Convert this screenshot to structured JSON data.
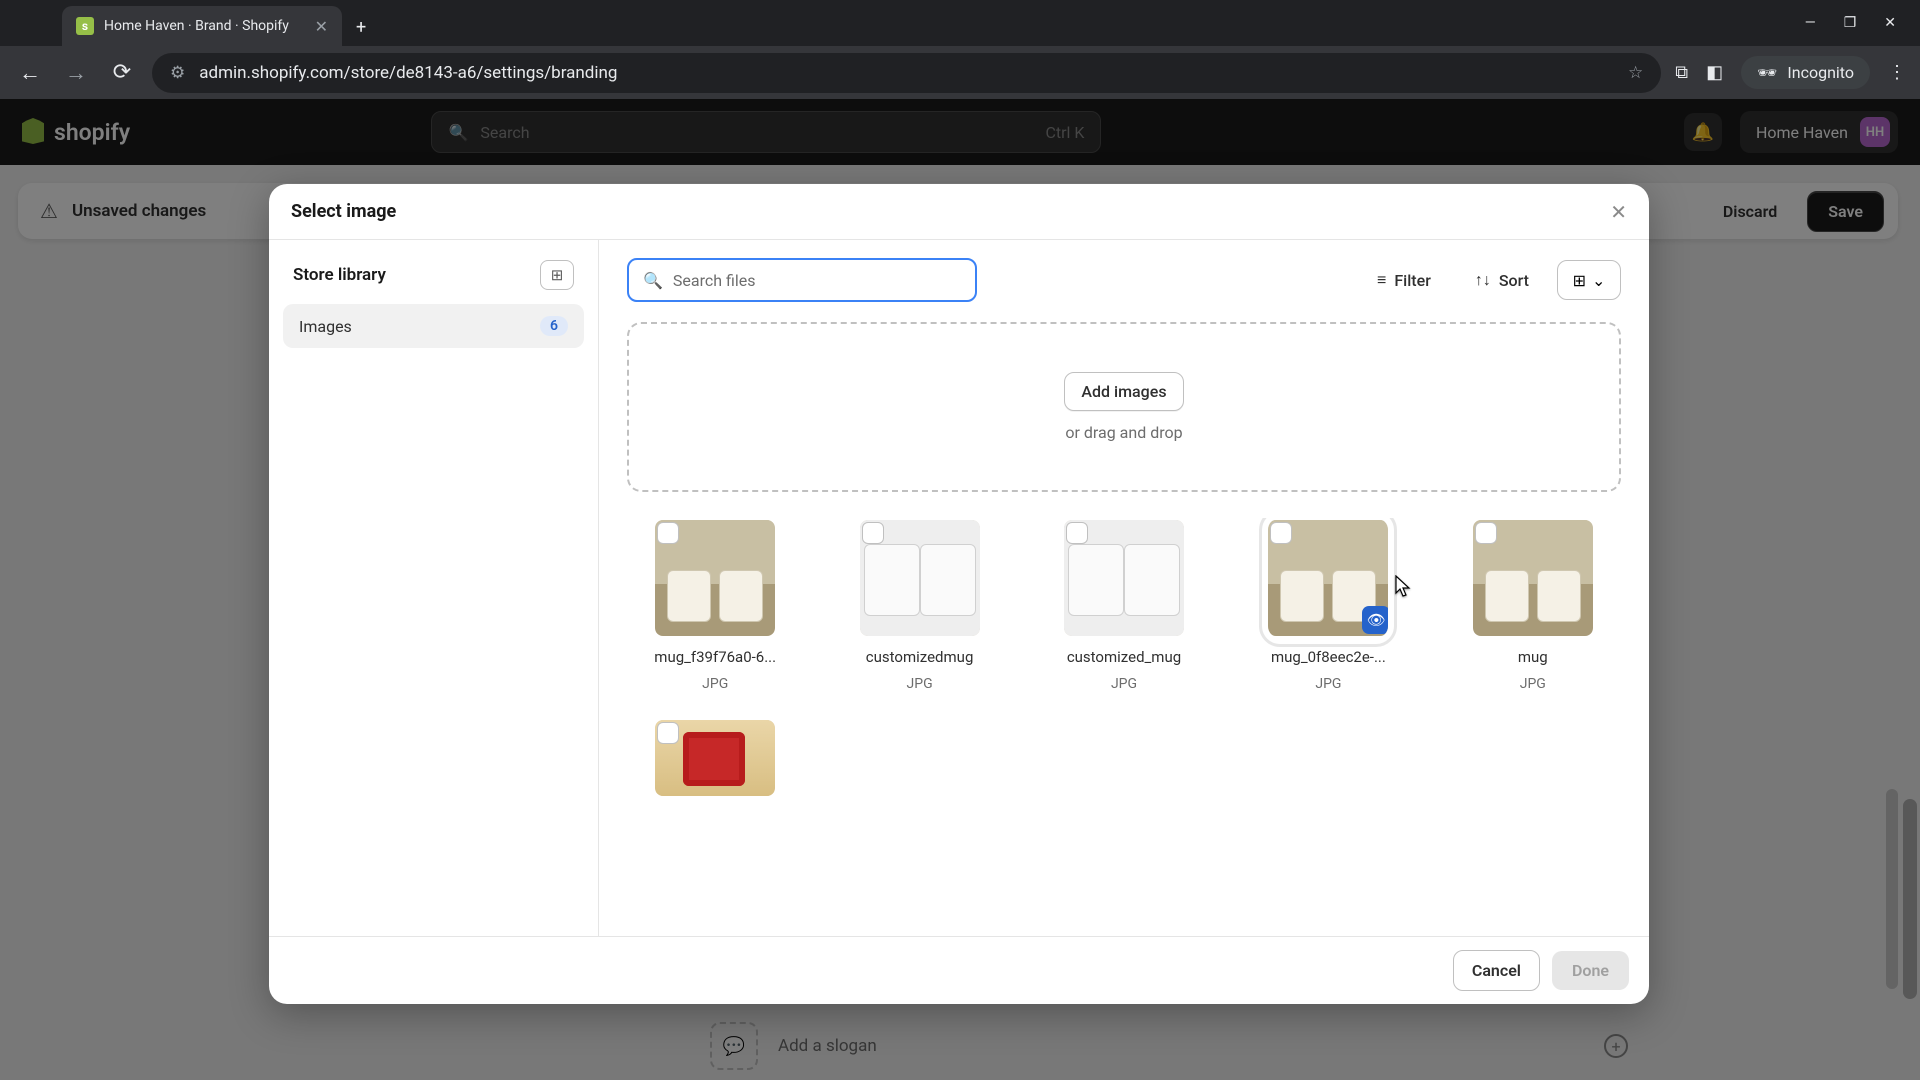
{
  "browser": {
    "tab_title": "Home Haven · Brand · Shopify",
    "url": "admin.shopify.com/store/de8143-a6/settings/branding",
    "incognito_label": "Incognito"
  },
  "header": {
    "search_placeholder": "Search",
    "search_shortcut": "Ctrl K",
    "store_name": "Home Haven",
    "store_initials": "HH"
  },
  "unsaved": {
    "text": "Unsaved changes",
    "discard": "Discard",
    "save": "Save"
  },
  "background": {
    "slogan_text": "Add a slogan"
  },
  "modal": {
    "title": "Select image",
    "sidebar_title": "Store library",
    "sidebar_item": "Images",
    "sidebar_count": "6",
    "search_placeholder": "Search files",
    "filter": "Filter",
    "sort": "Sort",
    "add_images": "Add images",
    "drag_hint": "or drag and drop",
    "cancel": "Cancel",
    "done": "Done"
  },
  "images": [
    {
      "name": "mug_f39f76a0-6...",
      "ext": "JPG",
      "variant": "scene"
    },
    {
      "name": "customizedmug",
      "ext": "JPG",
      "variant": "pair"
    },
    {
      "name": "customized_mug",
      "ext": "JPG",
      "variant": "pair"
    },
    {
      "name": "mug_0f8eec2e-...",
      "ext": "JPG",
      "variant": "scene",
      "hovered": true,
      "show_eye": true
    },
    {
      "name": "mug",
      "ext": "JPG",
      "variant": "scene"
    },
    {
      "name": "",
      "ext": "",
      "variant": "gift",
      "cut": true
    }
  ]
}
